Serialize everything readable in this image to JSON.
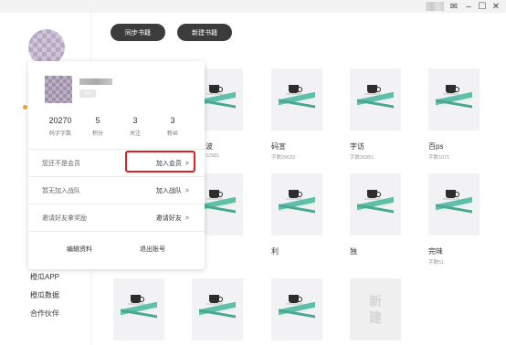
{
  "window": {
    "controls": [
      "✉",
      "–",
      "☐",
      "✕"
    ]
  },
  "toolbar": {
    "sync_label": "同步书籍",
    "new_label": "新建书籍"
  },
  "sidebar": {
    "links": [
      "橙瓜APP",
      "橙瓜数据",
      "合作伙伴"
    ]
  },
  "books": [
    {
      "title": "",
      "words": ""
    },
    {
      "title": "",
      "words": ""
    },
    {
      "title": "码宣",
      "words": "字数29032"
    },
    {
      "title": "字访",
      "words": "字数26951"
    },
    {
      "title": "百ps",
      "words": "字数1071"
    },
    {
      "title": "",
      "words": ""
    },
    {
      "title": "",
      "words": ""
    },
    {
      "title": "利",
      "words": ""
    },
    {
      "title": "独",
      "words": ""
    },
    {
      "title": "完味",
      "words": "字数51"
    },
    {
      "title": "",
      "words": ""
    },
    {
      "title": "",
      "words": ""
    },
    {
      "title": "",
      "words": ""
    }
  ],
  "partial_texts": {
    "title_fragment": "波",
    "words_fragment": "12981"
  },
  "new_book": {
    "line1": "新",
    "line2": "建"
  },
  "user_card": {
    "vip_badge": "VIP",
    "stats": [
      {
        "value": "20270",
        "label": "码字字数"
      },
      {
        "value": "5",
        "label": "积分"
      },
      {
        "value": "3",
        "label": "关注"
      },
      {
        "value": "3",
        "label": "粉丝"
      }
    ],
    "rows": [
      {
        "label": "您还不是会员",
        "action": "加入会员"
      },
      {
        "label": "暂无加入战队",
        "action": "加入战队"
      },
      {
        "label": "邀请好友拿奖励",
        "action": "邀请好友"
      }
    ],
    "chevron": ">",
    "edit_label": "编辑资料",
    "logout_label": "退出账号"
  },
  "colors": {
    "accent_dot": "#f5a623",
    "highlight": "#e02020",
    "book_green": "#5fbfa8",
    "pill": "#3c3c3c"
  }
}
